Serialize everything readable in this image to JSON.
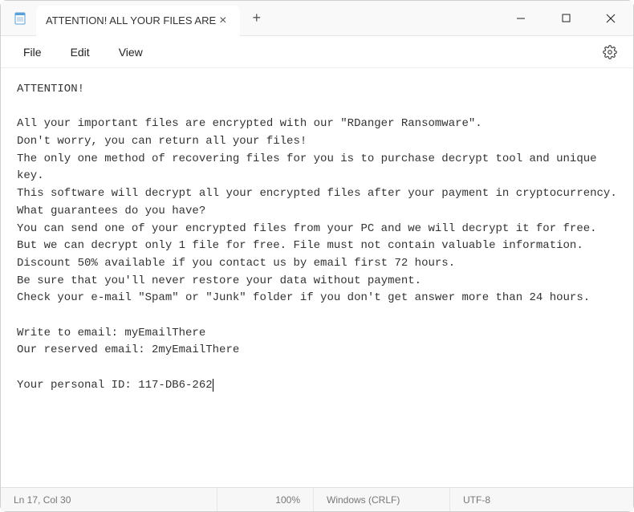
{
  "titlebar": {
    "tab_title": "ATTENTION! ALL YOUR FILES ARE",
    "icon_name": "notepad-icon"
  },
  "menu": {
    "file": "File",
    "edit": "Edit",
    "view": "View"
  },
  "content": {
    "body": "ATTENTION!\n\nAll your important files are encrypted with our \"RDanger Ransomware\".\nDon't worry, you can return all your files!\nThe only one method of recovering files for you is to purchase decrypt tool and unique key.\nThis software will decrypt all your encrypted files after your payment in cryptocurrency.\nWhat guarantees do you have?\nYou can send one of your encrypted files from your PC and we will decrypt it for free.\nBut we can decrypt only 1 file for free. File must not contain valuable information.\nDiscount 50% available if you contact us by email first 72 hours.\nBe sure that you'll never restore your data without payment.\nCheck your e-mail \"Spam\" or \"Junk\" folder if you don't get answer more than 24 hours.\n\nWrite to email: myEmailThere\nOur reserved email: 2myEmailThere\n\nYour personal ID: 117-DB6-262"
  },
  "statusbar": {
    "position": "Ln 17, Col 30",
    "zoom": "100%",
    "line_ending": "Windows (CRLF)",
    "encoding": "UTF-8"
  }
}
